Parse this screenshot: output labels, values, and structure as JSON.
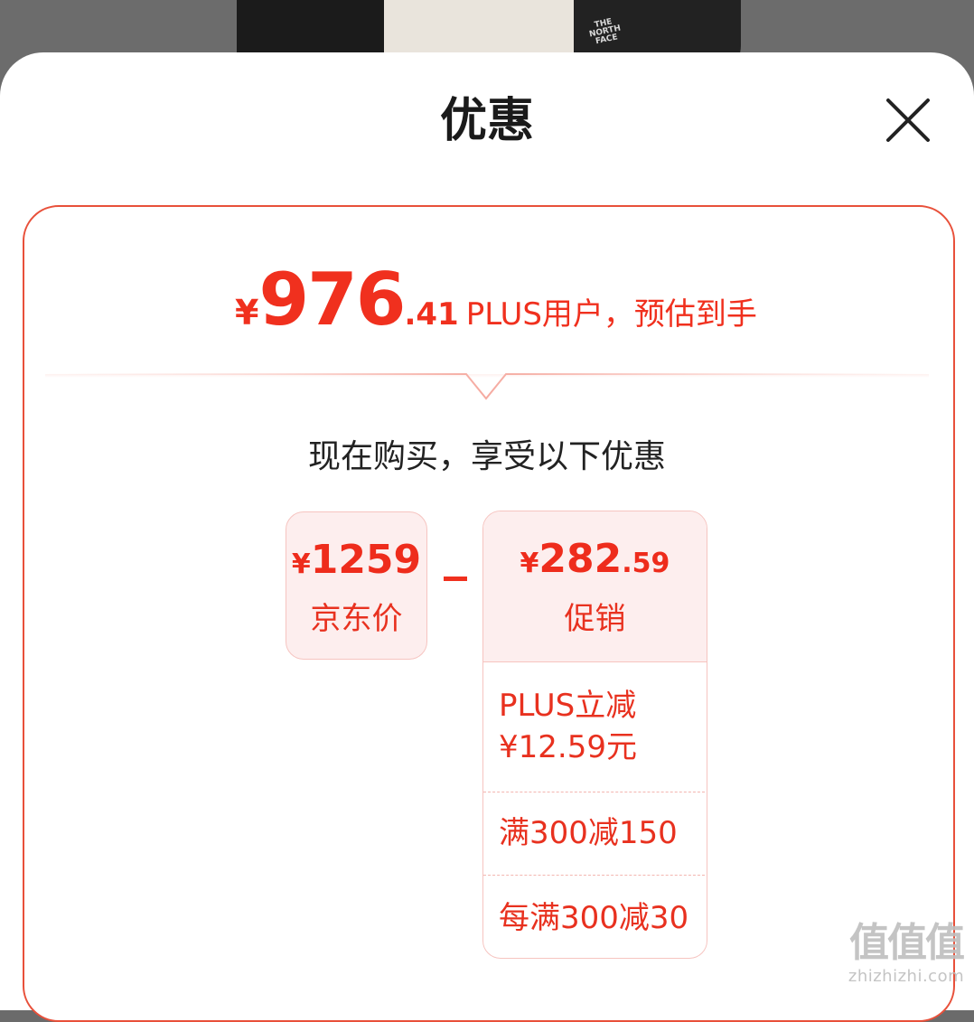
{
  "product_image": {
    "brand_lettering": "THE NORTH FACE"
  },
  "sheet": {
    "title": "优惠",
    "close_icon": "close-icon"
  },
  "estimate": {
    "yen": "¥",
    "amount_integer": "976",
    "amount_decimal": ".41",
    "note": "PLUS用户，预估到手"
  },
  "subtitle": "现在购买，享受以下优惠",
  "jd_price": {
    "yen": "¥",
    "amount_integer": "1259",
    "amount_decimal": "",
    "label": "京东价"
  },
  "operator": "−",
  "promotion": {
    "yen": "¥",
    "amount_integer": "282",
    "amount_decimal": ".59",
    "label": "促销",
    "items": [
      {
        "line1": "PLUS立减",
        "line2": "¥12.59元"
      },
      {
        "line1": "满300减150"
      },
      {
        "line1": "每满300减30"
      }
    ]
  },
  "watermark": {
    "glyphs": "值值值",
    "url": "zhizhizhi.com"
  },
  "colors": {
    "accent": "#f0301e",
    "panel_bg": "#fdeeee",
    "panel_border": "#f6c4c0",
    "card_border": "#e8503a"
  }
}
